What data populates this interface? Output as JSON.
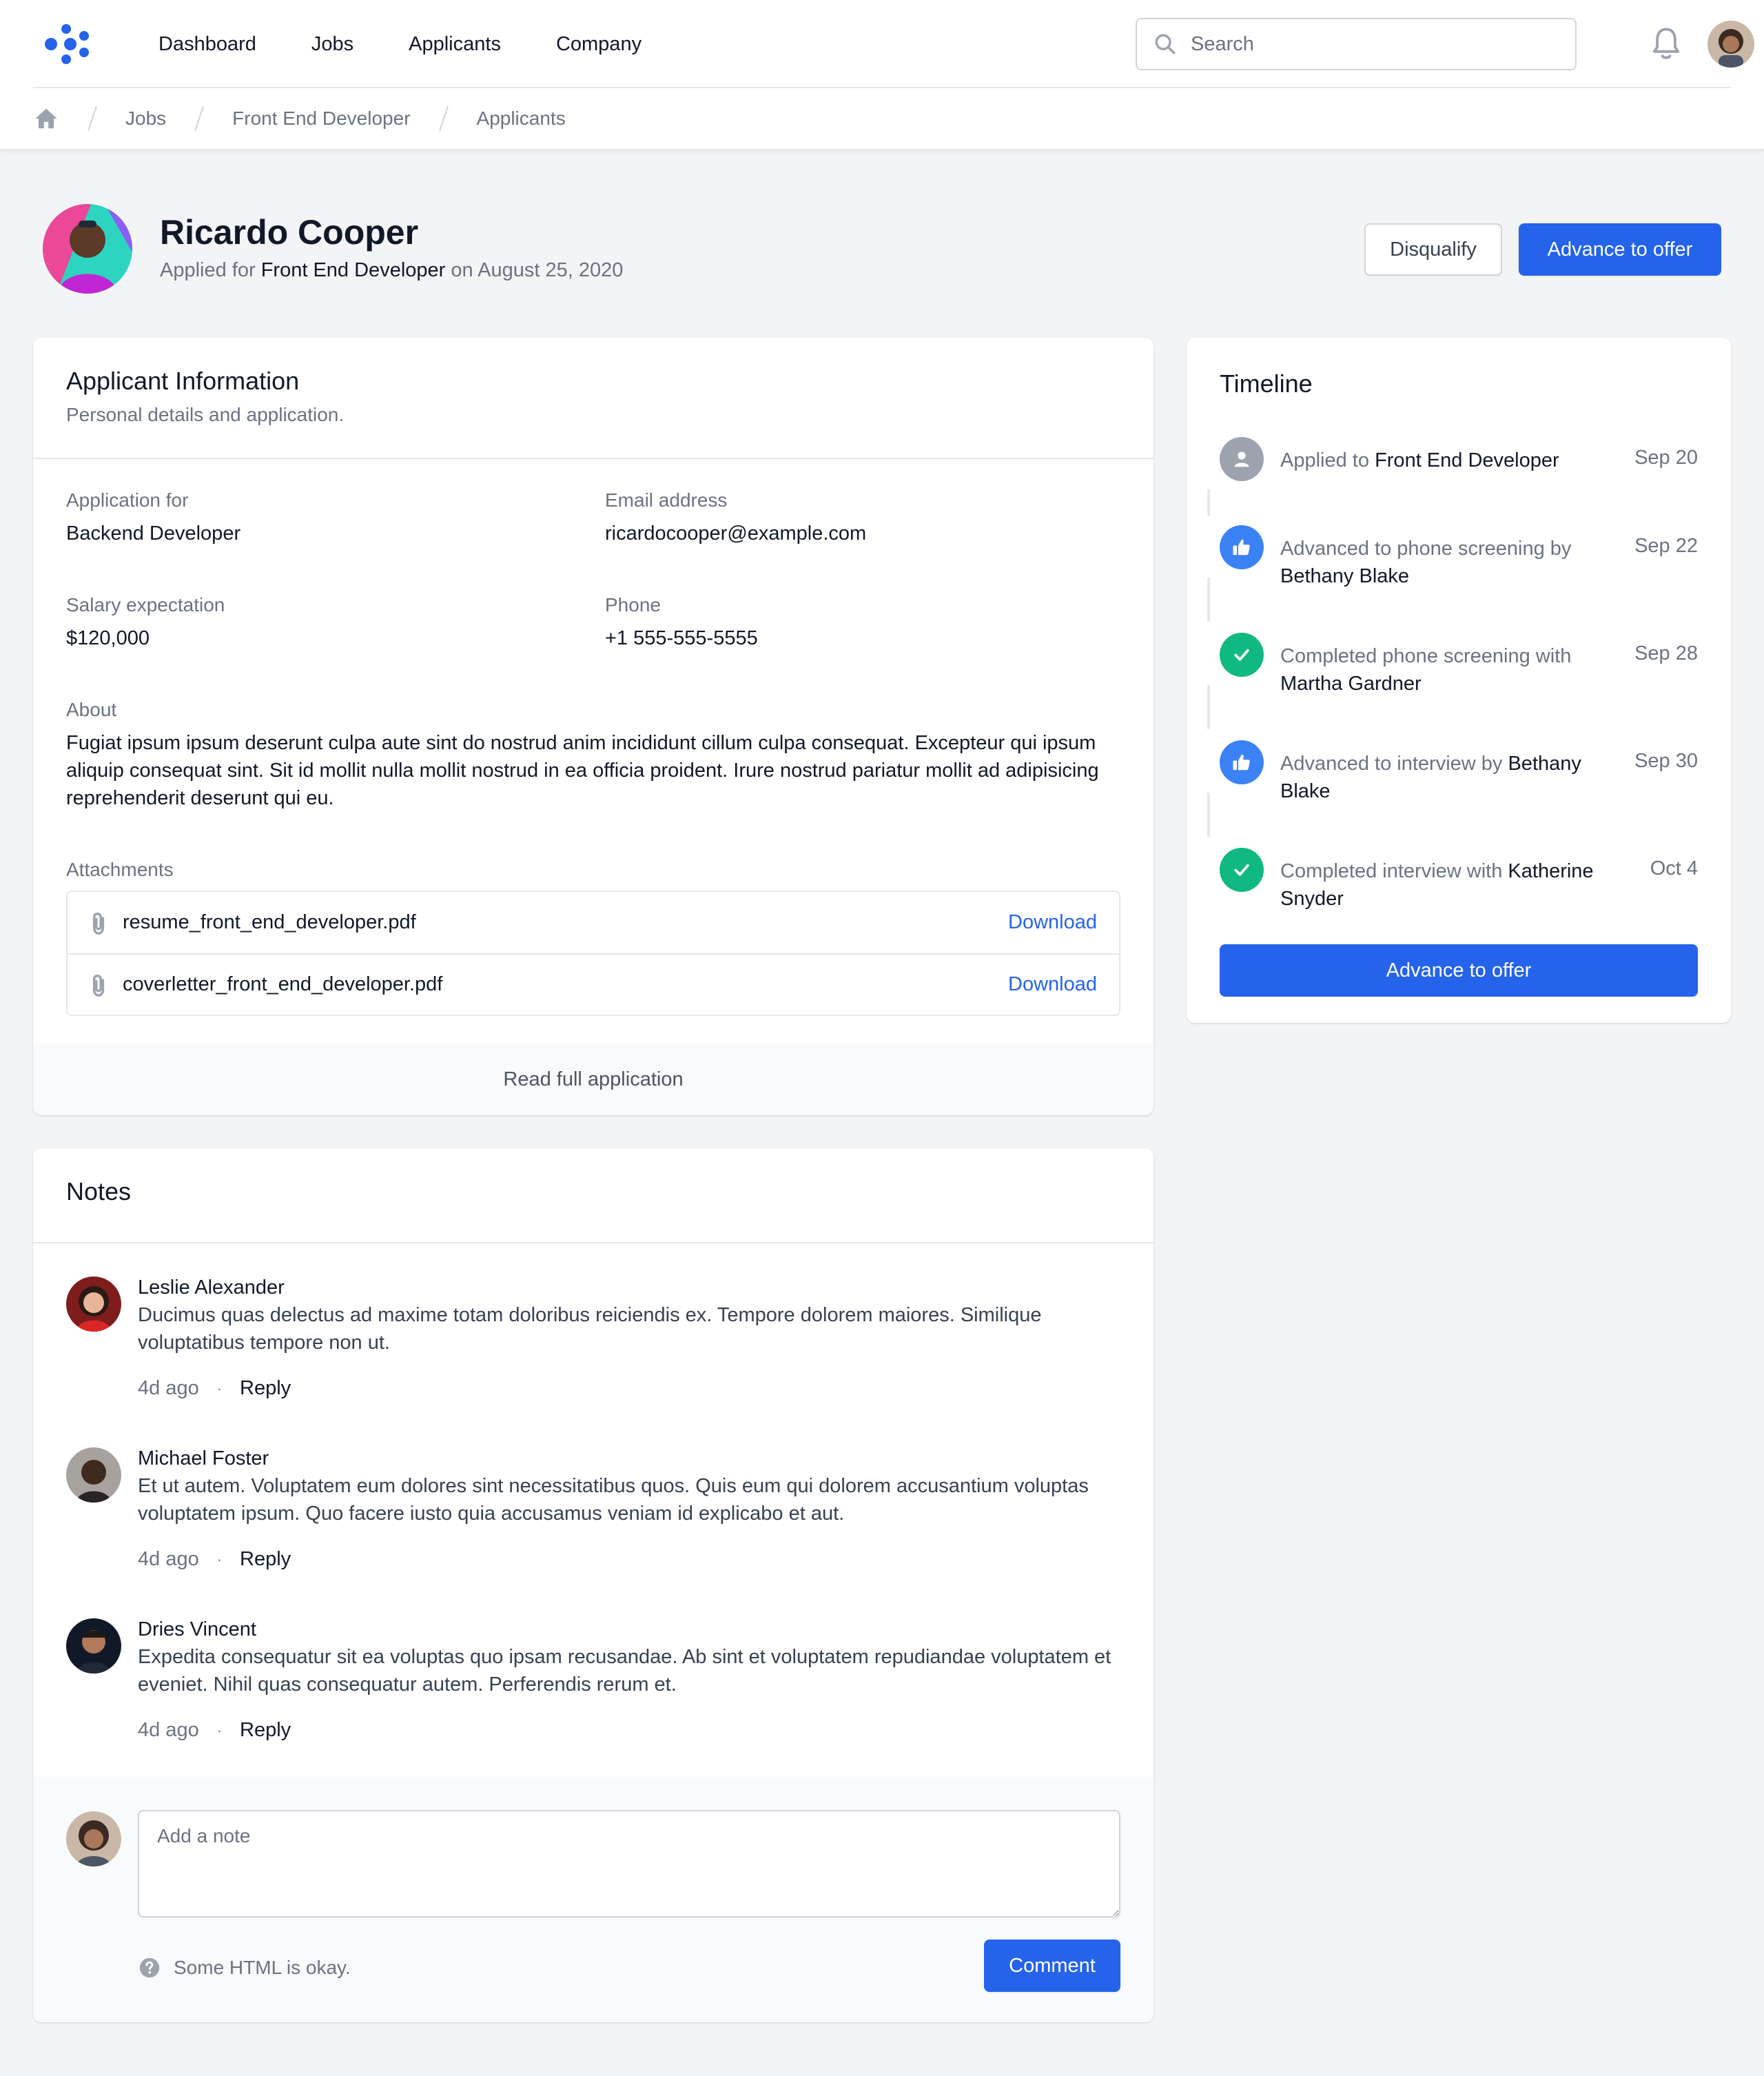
{
  "nav": {
    "links": [
      "Dashboard",
      "Jobs",
      "Applicants",
      "Company"
    ],
    "search_placeholder": "Search"
  },
  "breadcrumb": [
    "Jobs",
    "Front End Developer",
    "Applicants"
  ],
  "applicant": {
    "name": "Ricardo Cooper",
    "applied_prefix": "Applied for",
    "applied_job": "Front End Developer",
    "applied_on": "on",
    "applied_date": "August 25, 2020",
    "disqualify_label": "Disqualify",
    "advance_label": "Advance to offer"
  },
  "info": {
    "title": "Applicant Information",
    "subtitle": "Personal details and application.",
    "fields": [
      {
        "label": "Application for",
        "value": "Backend Developer"
      },
      {
        "label": "Email address",
        "value": "ricardocooper@example.com"
      },
      {
        "label": "Salary expectation",
        "value": "$120,000"
      },
      {
        "label": "Phone",
        "value": "+1 555-555-5555"
      }
    ],
    "about_label": "About",
    "about_text": "Fugiat ipsum ipsum deserunt culpa aute sint do nostrud anim incididunt cillum culpa consequat. Excepteur qui ipsum aliquip consequat sint. Sit id mollit nulla mollit nostrud in ea officia proident. Irure nostrud pariatur mollit ad adipisicing reprehenderit deserunt qui eu.",
    "attachments_label": "Attachments",
    "attachments": [
      {
        "name": "resume_front_end_developer.pdf",
        "action": "Download"
      },
      {
        "name": "coverletter_front_end_developer.pdf",
        "action": "Download"
      }
    ],
    "read_full": "Read full application"
  },
  "notes": {
    "title": "Notes",
    "items": [
      {
        "author": "Leslie Alexander",
        "text": "Ducimus quas delectus ad maxime totam doloribus reiciendis ex. Tempore dolorem maiores. Similique voluptatibus tempore non ut.",
        "ago": "4d ago",
        "dot": "·",
        "reply": "Reply"
      },
      {
        "author": "Michael Foster",
        "text": "Et ut autem. Voluptatem eum dolores sint necessitatibus quos. Quis eum qui dolorem accusantium voluptas voluptatem ipsum. Quo facere iusto quia accusamus veniam id explicabo et aut.",
        "ago": "4d ago",
        "dot": "·",
        "reply": "Reply"
      },
      {
        "author": "Dries Vincent",
        "text": "Expedita consequatur sit ea voluptas quo ipsam recusandae. Ab sint et voluptatem repudiandae voluptatem et eveniet. Nihil quas consequatur autem. Perferendis rerum et.",
        "ago": "4d ago",
        "dot": "·",
        "reply": "Reply"
      }
    ],
    "placeholder": "Add a note",
    "help": "Some HTML is okay.",
    "comment_label": "Comment"
  },
  "timeline": {
    "title": "Timeline",
    "items": [
      {
        "icon": "user-icon",
        "color": "#9ca3af",
        "pre": "Applied to",
        "who": "Front End Developer",
        "date": "Sep 20"
      },
      {
        "icon": "thumb-up-icon",
        "color": "#3b82f6",
        "pre": "Advanced to phone screening by",
        "who": "Bethany Blake",
        "date": "Sep 22"
      },
      {
        "icon": "check-icon",
        "color": "#10b981",
        "pre": "Completed phone screening with",
        "who": "Martha Gardner",
        "date": "Sep 28"
      },
      {
        "icon": "thumb-up-icon",
        "color": "#3b82f6",
        "pre": "Advanced to interview by",
        "who": "Bethany Blake",
        "date": "Sep 30"
      },
      {
        "icon": "check-icon",
        "color": "#10b981",
        "pre": "Completed interview with",
        "who": "Katherine Snyder",
        "date": "Oct 4"
      }
    ],
    "advance_label": "Advance to offer"
  },
  "colors": {
    "accent": "#2563eb",
    "success": "#10b981",
    "muted": "#9ca3af"
  }
}
